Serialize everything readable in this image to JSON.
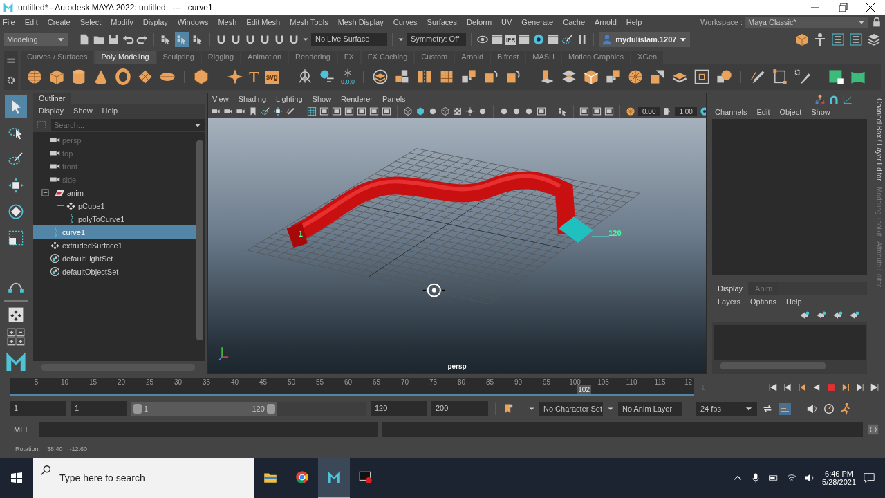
{
  "window": {
    "title": "untitled* - Autodesk MAYA 2022: untitled   ---   curve1"
  },
  "menu_bar": [
    "File",
    "Edit",
    "Create",
    "Select",
    "Modify",
    "Display",
    "Windows",
    "Mesh",
    "Edit Mesh",
    "Mesh Tools",
    "Mesh Display",
    "Curves",
    "Surfaces",
    "Deform",
    "UV",
    "Generate",
    "Cache",
    "Arnold",
    "Help"
  ],
  "workspace": {
    "label": "Workspace :",
    "value": "Maya Classic*"
  },
  "status_line": {
    "menu_set": "Modeling",
    "select_modes": [
      {
        "selected": false
      },
      {
        "selected": true
      },
      {
        "selected": false
      }
    ],
    "live_surface": "No Live Surface",
    "symmetry": "Symmetry: Off",
    "ipr_label": "IPR",
    "user": "mydulislam.1207"
  },
  "shelf": {
    "tabs": [
      {
        "label": "Curves / Surfaces",
        "selected": false
      },
      {
        "label": "Poly Modeling",
        "selected": true
      },
      {
        "label": "Sculpting",
        "selected": false
      },
      {
        "label": "Rigging",
        "selected": false
      },
      {
        "label": "Animation",
        "selected": false
      },
      {
        "label": "Rendering",
        "selected": false
      },
      {
        "label": "FX",
        "selected": false
      },
      {
        "label": "FX Caching",
        "selected": false
      },
      {
        "label": "Custom",
        "selected": false
      },
      {
        "label": "Arnold",
        "selected": false
      },
      {
        "label": "Bifrost",
        "selected": false
      },
      {
        "label": "MASH",
        "selected": false
      },
      {
        "label": "Motion Graphics",
        "selected": false
      },
      {
        "label": "XGen",
        "selected": false
      }
    ],
    "type_tool": "T",
    "svg_tool": "svg",
    "snap_readout": "0,0,0"
  },
  "toolbox": [
    {
      "selected": true
    },
    {
      "selected": false
    },
    {
      "selected": false
    },
    {
      "selected": false
    },
    {
      "selected": false
    },
    {
      "selected": false
    },
    {
      "selected": false
    }
  ],
  "outliner": {
    "title": "Outliner",
    "menu": [
      "Display",
      "Show",
      "Help"
    ],
    "search": {
      "placeholder": "Search..."
    },
    "items": [
      {
        "label": "persp",
        "kind": "camera",
        "dimmed": true,
        "selected": false
      },
      {
        "label": "top",
        "kind": "camera",
        "dimmed": true,
        "selected": false
      },
      {
        "label": "front",
        "kind": "camera",
        "dimmed": true,
        "selected": false
      },
      {
        "label": "side",
        "kind": "camera",
        "dimmed": true,
        "selected": false
      },
      {
        "label": "anim",
        "kind": "set",
        "dimmed": false,
        "selected": false,
        "expanded": true,
        "children": [
          {
            "label": "pCube1",
            "kind": "mesh",
            "dimmed": false,
            "selected": false
          },
          {
            "label": "polyToCurve1",
            "kind": "curve",
            "dimmed": false,
            "selected": false
          }
        ]
      },
      {
        "label": "curve1",
        "kind": "curve",
        "dimmed": false,
        "selected": true
      },
      {
        "label": "extrudedSurface1",
        "kind": "mesh",
        "dimmed": false,
        "selected": false
      },
      {
        "label": "defaultLightSet",
        "kind": "objectset",
        "dimmed": false,
        "selected": false
      },
      {
        "label": "defaultObjectSet",
        "kind": "objectset",
        "dimmed": false,
        "selected": false
      }
    ]
  },
  "viewport": {
    "menu": [
      "View",
      "Shading",
      "Lighting",
      "Show",
      "Renderer",
      "Panels"
    ],
    "fields": [
      "0.00",
      "1.00"
    ],
    "scene": {
      "start_label": "1",
      "end_label": "120"
    },
    "camera_label": "persp"
  },
  "channel_box": {
    "menu": [
      "Channels",
      "Edit",
      "Object",
      "Show"
    ]
  },
  "layer_editor": {
    "tabs": [
      {
        "label": "Display",
        "selected": true
      },
      {
        "label": "Anim",
        "selected": false
      }
    ],
    "menu": [
      "Layers",
      "Options",
      "Help"
    ]
  },
  "side_tabs": [
    {
      "label": "Channel Box / Layer Editor",
      "selected": true
    },
    {
      "label": "Modeling Toolkit",
      "selected": false
    },
    {
      "label": "Attribute Editor",
      "selected": false
    }
  ],
  "time_slider": {
    "ticks": [
      "5",
      "10",
      "15",
      "20",
      "25",
      "30",
      "35",
      "40",
      "45",
      "50",
      "55",
      "60",
      "65",
      "70",
      "75",
      "80",
      "85",
      "90",
      "95",
      "100",
      "105",
      "110",
      "115",
      "12"
    ],
    "current_frame": "102",
    "level": 0.849,
    "frame_field": "1"
  },
  "range_slider": {
    "level": 0.62,
    "start": "1",
    "playback_start": "1",
    "range_start": "1",
    "range_end": "120",
    "playback_end": "120",
    "end": "200",
    "character_set": "No Character Set",
    "anim_layer": "No Anim Layer",
    "fps": "24 fps"
  },
  "command_line": {
    "label": "MEL"
  },
  "help_line": {
    "label": "Rotation:",
    "values": [
      "38.40",
      "-12.60"
    ]
  },
  "taskbar": {
    "search_placeholder": "Type here to search",
    "apps": [
      {
        "selected": false
      },
      {
        "selected": false
      },
      {
        "selected": true
      },
      {
        "selected": false
      }
    ],
    "time": "6:46 PM",
    "date": "5/28/2021"
  }
}
